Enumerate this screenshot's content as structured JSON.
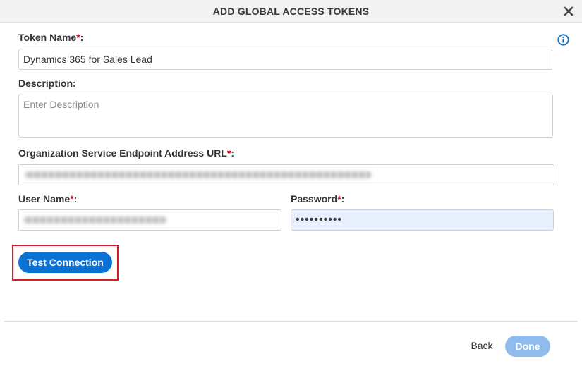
{
  "dialog": {
    "title": "ADD GLOBAL ACCESS TOKENS",
    "close_icon": "close-icon",
    "info_icon": "info-icon"
  },
  "form": {
    "token_name": {
      "label": "Token Name",
      "required_mark": "*",
      "suffix": ":",
      "value": "Dynamics 365 for Sales Lead"
    },
    "description": {
      "label": "Description:",
      "placeholder": "Enter Description",
      "value": ""
    },
    "endpoint_url": {
      "label": "Organization Service Endpoint Address URL",
      "required_mark": "*",
      "suffix": ":"
    },
    "user_name": {
      "label": "User Name",
      "required_mark": "*",
      "suffix": ":"
    },
    "password": {
      "label": "Password",
      "required_mark": "*",
      "suffix": ":",
      "value": "••••••••••"
    }
  },
  "actions": {
    "test_connection": "Test Connection",
    "back": "Back",
    "done": "Done"
  },
  "colors": {
    "primary": "#0a72d4",
    "primary_disabled": "#8fbcec",
    "required": "#d0021b",
    "highlight": "#d91c1c",
    "autofill": "#e8f0fe"
  }
}
